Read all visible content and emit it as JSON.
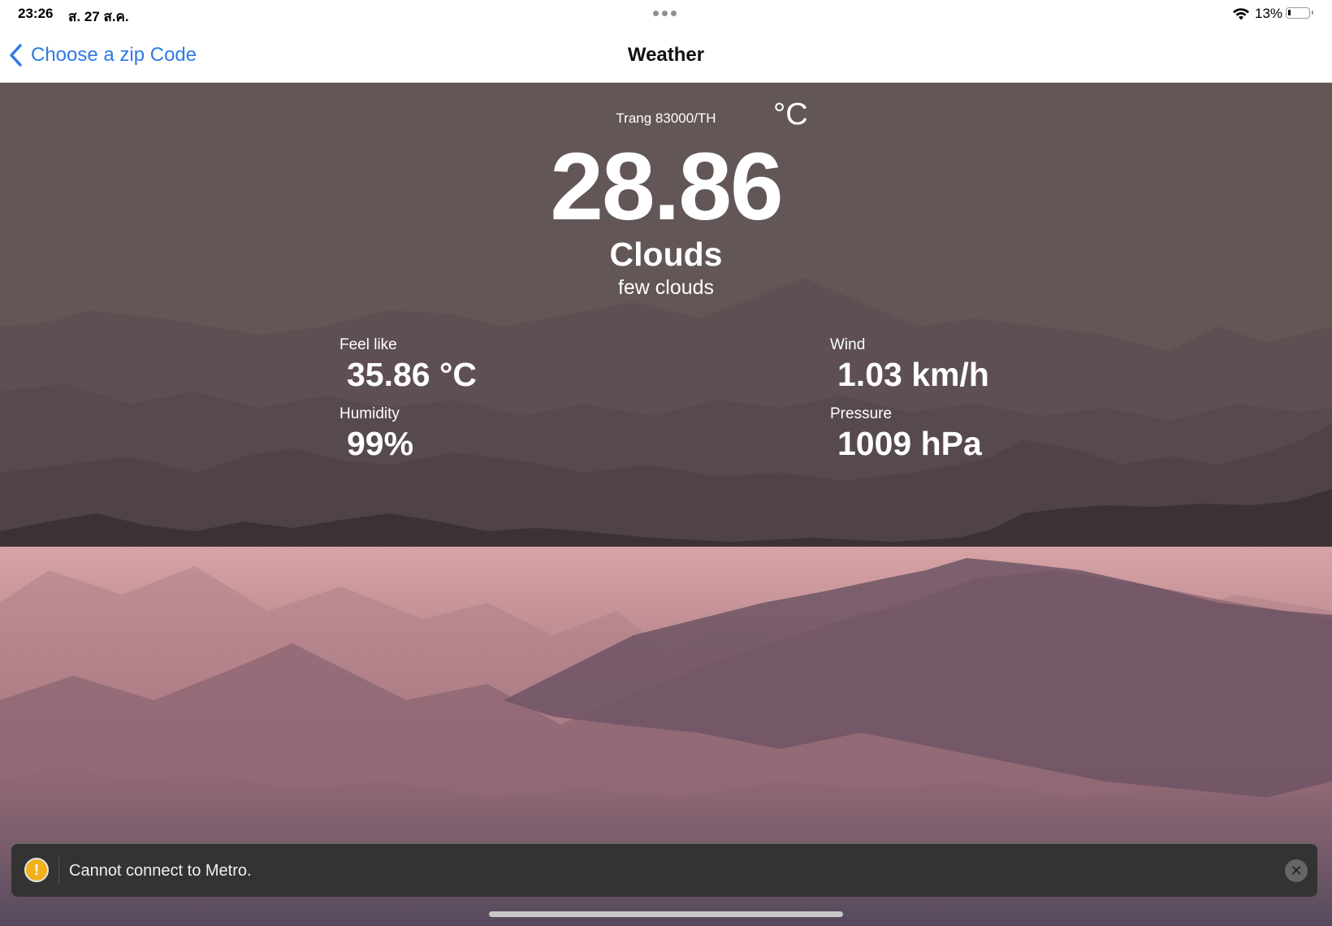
{
  "status_bar": {
    "time": "23:26",
    "date": "ส. 27 ส.ค.",
    "battery_percent": "13%",
    "battery_level": 0.13,
    "icons": [
      "wifi-icon",
      "battery-icon",
      "multitask-dots-icon"
    ]
  },
  "nav": {
    "back_label": "Choose a zip Code",
    "back_icon": "chevron-left-icon",
    "title": "Weather",
    "accent_color": "#2f7ae5"
  },
  "weather": {
    "location": "Trang 83000/TH",
    "temperature": "28.86",
    "temperature_unit": "°C",
    "condition": "Clouds",
    "description": "few clouds",
    "stats": {
      "feel_like": {
        "label": "Feel like",
        "value": "35.86 °C"
      },
      "wind": {
        "label": "Wind",
        "value": "1.03 km/h"
      },
      "humidity": {
        "label": "Humidity",
        "value": "99%"
      },
      "pressure": {
        "label": "Pressure",
        "value": "1009 hPa"
      }
    }
  },
  "toast": {
    "message": "Cannot connect to Metro.",
    "icon": "warning-icon",
    "close_icon": "close-icon",
    "warning_color": "#f2b01e"
  }
}
